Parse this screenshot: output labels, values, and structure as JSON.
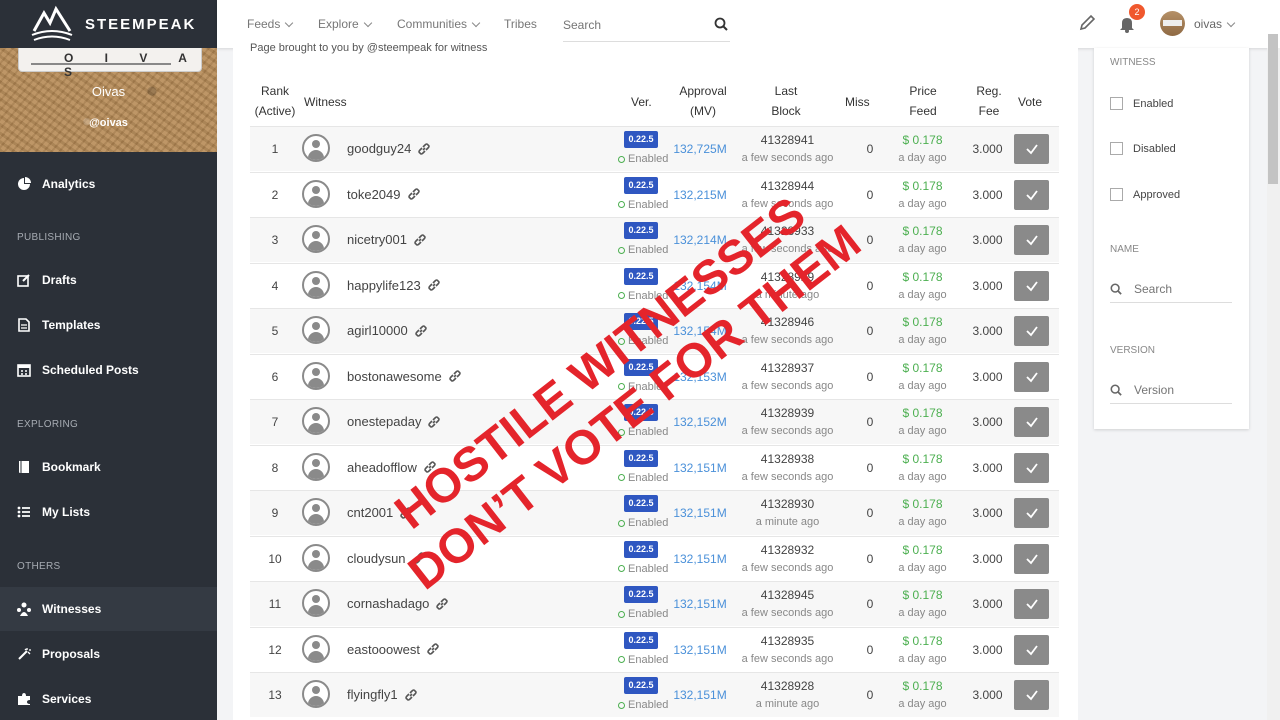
{
  "brand": {
    "logo_text": "STEEMPEAK"
  },
  "profile": {
    "name": "Oivas",
    "handle": "@oivas",
    "card_text": "O I V A S"
  },
  "sidebar": {
    "analytics": "Analytics",
    "section_publishing": "PUBLISHING",
    "drafts": "Drafts",
    "templates": "Templates",
    "scheduled": "Scheduled Posts",
    "section_exploring": "EXPLORING",
    "bookmark": "Bookmark",
    "lists": "My Lists",
    "section_others": "OTHERS",
    "witnesses": "Witnesses",
    "proposals": "Proposals",
    "services": "Services"
  },
  "topbar": {
    "feeds": "Feeds",
    "explore": "Explore",
    "communities": "Communities",
    "tribes": "Tribes",
    "search_placeholder": "Search",
    "notifications": "2",
    "username": "oivas"
  },
  "main": {
    "intro": "Page brought to you by @steempeak for witness",
    "headers": {
      "rank": "Rank",
      "active": "(Active)",
      "witness": "Witness",
      "ver": "Ver.",
      "approval": "Approval",
      "mv": "(MV)",
      "last": "Last",
      "block": "Block",
      "miss": "Miss",
      "price": "Price",
      "feed": "Feed",
      "reg": "Reg.",
      "fee": "Fee",
      "vote": "Vote"
    },
    "rows": [
      {
        "rank": "1",
        "name": "goodguy24",
        "ver": "0.22.5",
        "status": "Enabled",
        "approval": "132,725M",
        "block": "41328941",
        "ago": "a few seconds ago",
        "miss": "0",
        "price": "$ 0.178",
        "price_ago": "a day ago",
        "fee": "3.000"
      },
      {
        "rank": "2",
        "name": "toke2049",
        "ver": "0.22.5",
        "status": "Enabled",
        "approval": "132,215M",
        "block": "41328944",
        "ago": "a few seconds ago",
        "miss": "0",
        "price": "$ 0.178",
        "price_ago": "a day ago",
        "fee": "3.000"
      },
      {
        "rank": "3",
        "name": "nicetry001",
        "ver": "0.22.5",
        "status": "Enabled",
        "approval": "132,214M",
        "block": "41328933",
        "ago": "a few seconds ago",
        "miss": "0",
        "price": "$ 0.178",
        "price_ago": "a day ago",
        "fee": "3.000"
      },
      {
        "rank": "4",
        "name": "happylife123",
        "ver": "0.22.5",
        "status": "Enabled",
        "approval": "132,154M",
        "block": "41328929",
        "ago": "a minute ago",
        "miss": "0",
        "price": "$ 0.178",
        "price_ago": "a day ago",
        "fee": "3.000"
      },
      {
        "rank": "5",
        "name": "agirl10000",
        "ver": "0.22.5",
        "status": "Enabled",
        "approval": "132,154M",
        "block": "41328946",
        "ago": "a few seconds ago",
        "miss": "0",
        "price": "$ 0.178",
        "price_ago": "a day ago",
        "fee": "3.000"
      },
      {
        "rank": "6",
        "name": "bostonawesome",
        "ver": "0.22.5",
        "status": "Enabled",
        "approval": "132,153M",
        "block": "41328937",
        "ago": "a few seconds ago",
        "miss": "0",
        "price": "$ 0.178",
        "price_ago": "a day ago",
        "fee": "3.000"
      },
      {
        "rank": "7",
        "name": "onestepaday",
        "ver": "0.22.5",
        "status": "Enabled",
        "approval": "132,152M",
        "block": "41328939",
        "ago": "a few seconds ago",
        "miss": "0",
        "price": "$ 0.178",
        "price_ago": "a day ago",
        "fee": "3.000"
      },
      {
        "rank": "8",
        "name": "aheadofflow",
        "ver": "0.22.5",
        "status": "Enabled",
        "approval": "132,151M",
        "block": "41328938",
        "ago": "a few seconds ago",
        "miss": "0",
        "price": "$ 0.178",
        "price_ago": "a day ago",
        "fee": "3.000"
      },
      {
        "rank": "9",
        "name": "cnt2001",
        "ver": "0.22.5",
        "status": "Enabled",
        "approval": "132,151M",
        "block": "41328930",
        "ago": "a minute ago",
        "miss": "0",
        "price": "$ 0.178",
        "price_ago": "a day ago",
        "fee": "3.000"
      },
      {
        "rank": "10",
        "name": "cloudysun",
        "ver": "0.22.5",
        "status": "Enabled",
        "approval": "132,151M",
        "block": "41328932",
        "ago": "a few seconds ago",
        "miss": "0",
        "price": "$ 0.178",
        "price_ago": "a day ago",
        "fee": "3.000"
      },
      {
        "rank": "11",
        "name": "cornashadago",
        "ver": "0.22.5",
        "status": "Enabled",
        "approval": "132,151M",
        "block": "41328945",
        "ago": "a few seconds ago",
        "miss": "0",
        "price": "$ 0.178",
        "price_ago": "a day ago",
        "fee": "3.000"
      },
      {
        "rank": "12",
        "name": "eastooowest",
        "ver": "0.22.5",
        "status": "Enabled",
        "approval": "132,151M",
        "block": "41328935",
        "ago": "a few seconds ago",
        "miss": "0",
        "price": "$ 0.178",
        "price_ago": "a day ago",
        "fee": "3.000"
      },
      {
        "rank": "13",
        "name": "flyingfly1",
        "ver": "0.22.5",
        "status": "Enabled",
        "approval": "132,151M",
        "block": "41328928",
        "ago": "a minute ago",
        "miss": "0",
        "price": "$ 0.178",
        "price_ago": "a day ago",
        "fee": "3.000"
      }
    ]
  },
  "filter": {
    "witness_head": "WITNESS",
    "enabled": "Enabled",
    "disabled": "Disabled",
    "approved": "Approved",
    "name_head": "NAME",
    "name_placeholder": "Search",
    "version_head": "VERSION",
    "version_placeholder": "Version"
  },
  "overlay": {
    "line1": "HOSTILE WITNESSES",
    "line2": "DON’T VOTE FOR THEM"
  },
  "colors": {
    "sidebar": "#2b3038",
    "accent_green": "#4caf50",
    "version_blue": "#2f57c1",
    "overlay_red": "#e4242b",
    "badge": "#f0582d"
  }
}
